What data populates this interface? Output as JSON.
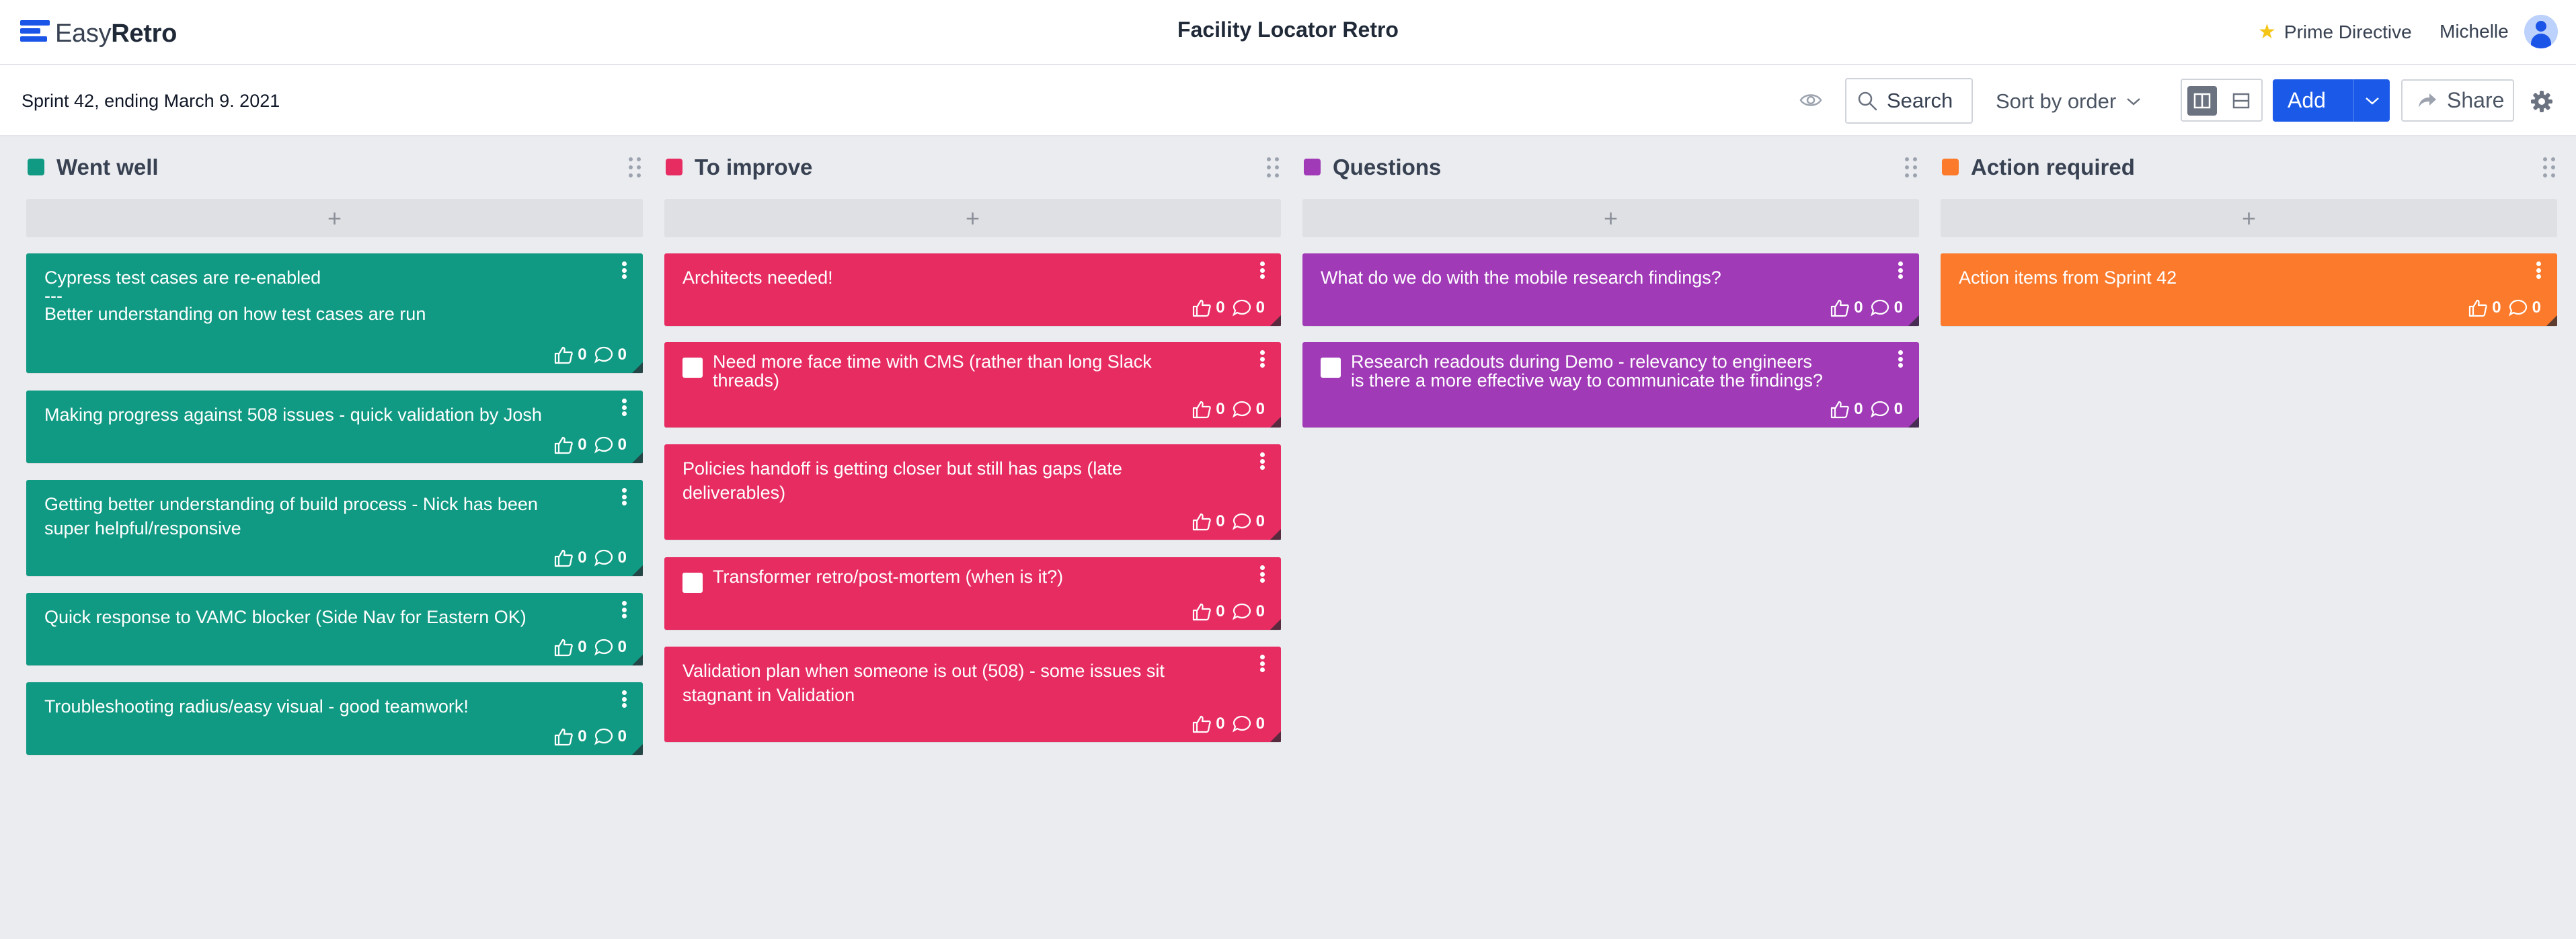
{
  "app": {
    "logo_light": "Easy",
    "logo_bold": "Retro",
    "board_title": "Facility Locator Retro",
    "prime_directive": "Prime Directive",
    "user_name": "Michelle"
  },
  "toolbar": {
    "sprint_label": "Sprint 42, ending March 9. 2021",
    "search_label": "Search",
    "sort_label": "Sort by order",
    "add_label": "Add",
    "share_label": "Share"
  },
  "colors": {
    "went_well": "#119a83",
    "to_improve": "#e72c62",
    "questions": "#a03ab7",
    "action_required": "#fb7a2c",
    "primary": "#1b5ae8"
  },
  "icons": [
    "logo-icon",
    "star-icon",
    "avatar-icon",
    "eye-icon",
    "search-icon",
    "chevron-down-icon",
    "columns-view-icon",
    "rows-view-icon",
    "share-icon",
    "gear-icon",
    "drag-handle-icon",
    "plus-icon",
    "kebab-menu-icon",
    "thumbs-up-icon",
    "comment-icon"
  ],
  "add_symbol": "+",
  "columns": [
    {
      "title": "Went well",
      "cards": [
        {
          "line1": "Cypress test cases are re-enabled",
          "line2": "---",
          "line3": "Better understanding on how test cases are run",
          "likes": "0",
          "comments": "0"
        },
        {
          "text": "Making progress against 508 issues - quick validation by Josh",
          "likes": "0",
          "comments": "0"
        },
        {
          "line1": "Getting better understanding of build process - Nick has been",
          "line2": "super helpful/responsive",
          "likes": "0",
          "comments": "0"
        },
        {
          "text": "Quick response to VAMC blocker (Side Nav for Eastern OK)",
          "likes": "0",
          "comments": "0"
        },
        {
          "text": "Troubleshooting radius/easy visual - good teamwork!",
          "likes": "0",
          "comments": "0"
        }
      ]
    },
    {
      "title": "To improve",
      "cards": [
        {
          "text": "Architects needed!",
          "likes": "0",
          "comments": "0"
        },
        {
          "line1": "Need more face time with CMS (rather than long Slack",
          "line2": "threads)",
          "likes": "0",
          "comments": "0"
        },
        {
          "line1": "Policies handoff is getting closer but still has gaps (late",
          "line2": "deliverables)",
          "likes": "0",
          "comments": "0"
        },
        {
          "text": "Transformer retro/post-mortem (when is it?)",
          "likes": "0",
          "comments": "0"
        },
        {
          "line1": "Validation plan when someone is out (508) - some issues sit",
          "line2": "stagnant in Validation",
          "likes": "0",
          "comments": "0"
        }
      ]
    },
    {
      "title": "Questions",
      "cards": [
        {
          "text": "What do we do with the mobile research findings?",
          "likes": "0",
          "comments": "0"
        },
        {
          "line1": "Research readouts during Demo - relevancy to engineers",
          "line2": "is there a more effective way to communicate the findings?",
          "likes": "0",
          "comments": "0"
        }
      ]
    },
    {
      "title": "Action required",
      "cards": [
        {
          "text": "Action items from Sprint 42",
          "likes": "0",
          "comments": "0"
        }
      ]
    }
  ]
}
